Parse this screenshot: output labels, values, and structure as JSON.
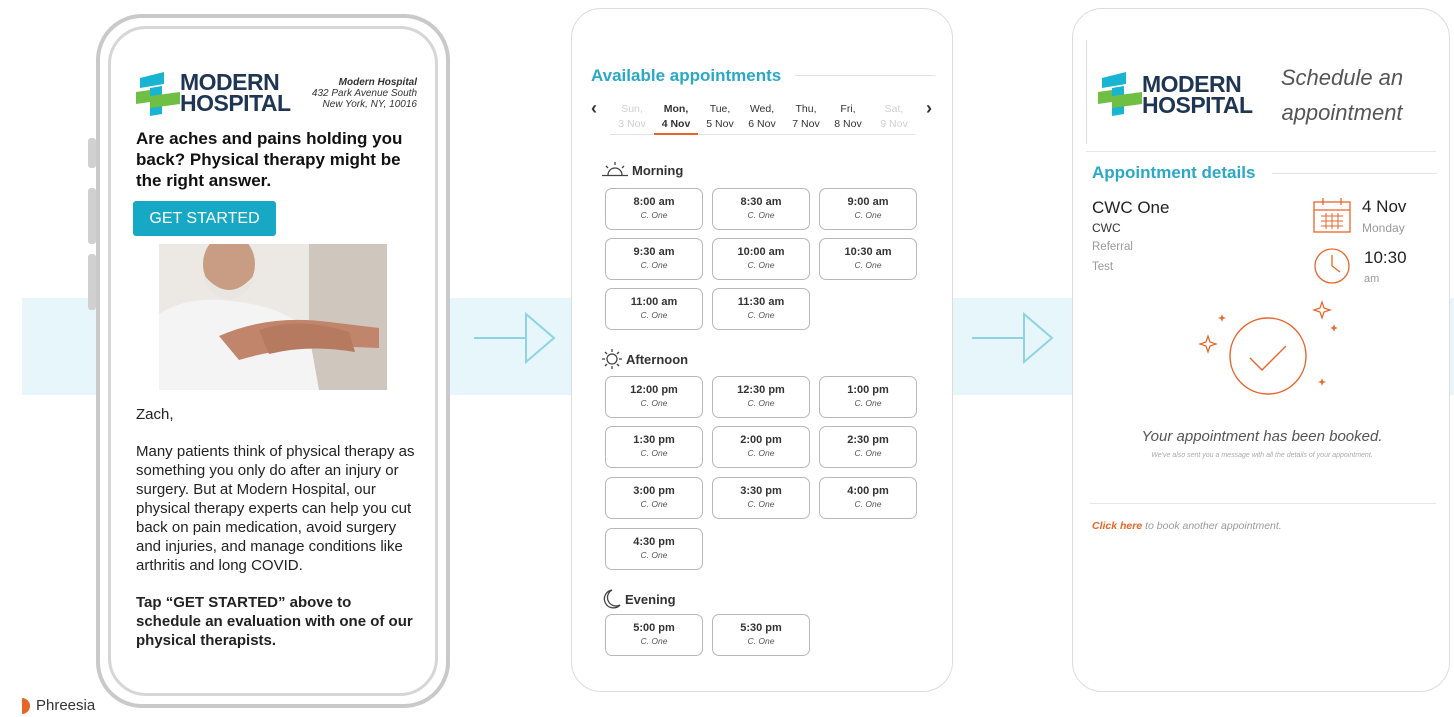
{
  "brand": {
    "name": "Phreesia",
    "color": "#e8652a"
  },
  "colors": {
    "accent": "#2aa8c6",
    "cta": "#17a8c6",
    "highlight": "#e8652a",
    "band": "#e6f6fa"
  },
  "email": {
    "logo_line1": "MODERN",
    "logo_line2": "HOSPITAL",
    "hospital_name": "Modern Hospital",
    "address_line1": "432 Park Avenue South",
    "address_line2": "New York, NY, 10016",
    "headline": "Are aches and pains holding you back? Physical therapy might be the right answer.",
    "cta_label": "GET STARTED",
    "image_icon": "therapy-photo",
    "greeting": "Zach,",
    "body": "Many patients think of physical therapy as something you only do after an injury or surgery. But at Modern Hospital, our physical therapy experts can help you cut back on pain medication, avoid surgery and injuries, and manage conditions like arthritis and long COVID.",
    "closing": "Tap “GET STARTED” above to schedule an evaluation with one of our physical therapists."
  },
  "booking": {
    "title": "Available appointments",
    "prev_icon": "chevron-left-icon",
    "next_icon": "chevron-right-icon",
    "days": [
      {
        "name": "Sun,",
        "date": "3 Nov",
        "state": "disabled"
      },
      {
        "name": "Mon,",
        "date": "4 Nov",
        "state": "selected"
      },
      {
        "name": "Tue,",
        "date": "5 Nov",
        "state": "normal"
      },
      {
        "name": "Wed,",
        "date": "6 Nov",
        "state": "normal"
      },
      {
        "name": "Thu,",
        "date": "7 Nov",
        "state": "normal"
      },
      {
        "name": "Fri,",
        "date": "8 Nov",
        "state": "normal"
      },
      {
        "name": "Sat,",
        "date": "9 Nov",
        "state": "disabled"
      }
    ],
    "periods": [
      {
        "name": "Morning",
        "icon": "sunrise-icon",
        "slots": [
          {
            "time": "8:00 am",
            "loc": "C. One"
          },
          {
            "time": "8:30 am",
            "loc": "C. One"
          },
          {
            "time": "9:00 am",
            "loc": "C. One"
          },
          {
            "time": "9:30 am",
            "loc": "C. One"
          },
          {
            "time": "10:00 am",
            "loc": "C. One"
          },
          {
            "time": "10:30 am",
            "loc": "C. One"
          },
          {
            "time": "11:00 am",
            "loc": "C. One"
          },
          {
            "time": "11:30 am",
            "loc": "C. One"
          }
        ]
      },
      {
        "name": "Afternoon",
        "icon": "sun-icon",
        "slots": [
          {
            "time": "12:00 pm",
            "loc": "C. One"
          },
          {
            "time": "12:30 pm",
            "loc": "C. One"
          },
          {
            "time": "1:00 pm",
            "loc": "C. One"
          },
          {
            "time": "1:30 pm",
            "loc": "C. One"
          },
          {
            "time": "2:00 pm",
            "loc": "C. One"
          },
          {
            "time": "2:30 pm",
            "loc": "C. One"
          },
          {
            "time": "3:00 pm",
            "loc": "C. One"
          },
          {
            "time": "3:30 pm",
            "loc": "C. One"
          },
          {
            "time": "4:00 pm",
            "loc": "C. One"
          },
          {
            "time": "4:30 pm",
            "loc": "C. One"
          }
        ]
      },
      {
        "name": "Evening",
        "icon": "moon-icon",
        "slots": [
          {
            "time": "5:00 pm",
            "loc": "C. One"
          },
          {
            "time": "5:30 pm",
            "loc": "C. One"
          }
        ]
      }
    ]
  },
  "confirmation": {
    "logo_line1": "MODERN",
    "logo_line2": "HOSPITAL",
    "header": "Schedule an appointment",
    "details_title": "Appointment details",
    "location_name": "CWC One",
    "location_code": "CWC",
    "type": "Referral",
    "note": "Test",
    "date": "4 Nov",
    "weekday": "Monday",
    "time": "10:30",
    "ampm": "am",
    "message": "Your appointment has been booked.",
    "sub_message": "We've also sent you a message with all the details of your appointment.",
    "link_label": "Click here",
    "link_rest": " to book another appointment."
  }
}
